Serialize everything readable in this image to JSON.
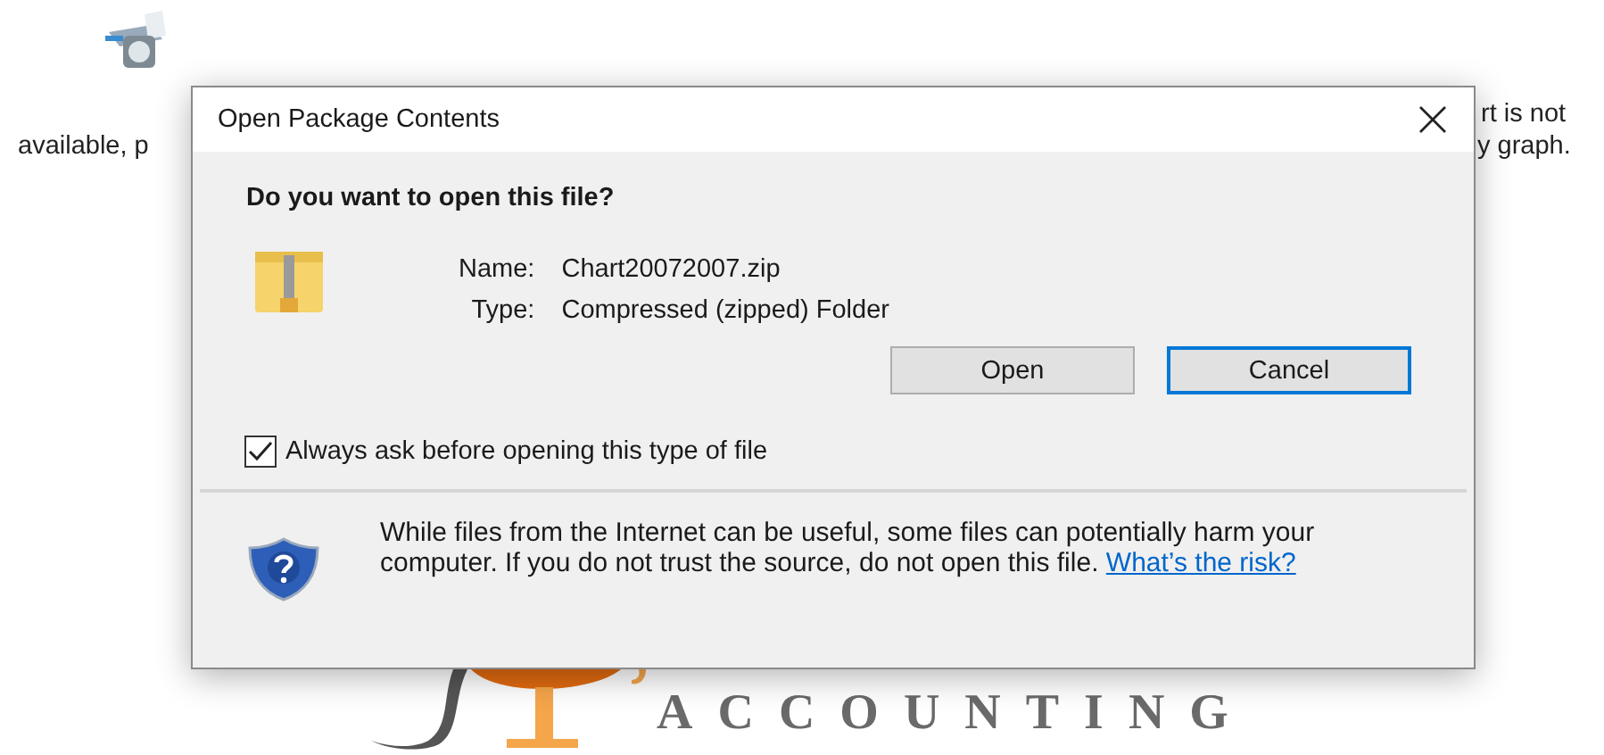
{
  "background": {
    "texts": [
      {
        "kind": "left",
        "text": "available, p"
      },
      {
        "kind": "right-top",
        "text": "rt is not"
      },
      {
        "kind": "right",
        "text": "y graph."
      }
    ],
    "logo": {
      "text": "ACCOUNTING"
    }
  },
  "dialog": {
    "title": "Open Package Contents",
    "heading": "Do you want to open this file?",
    "fields": [
      {
        "label": "Name:",
        "value": "Chart20072007.zip"
      },
      {
        "label": "Type:",
        "value": "Compressed (zipped) Folder"
      }
    ],
    "buttons": [
      {
        "label": "Open",
        "default": false
      },
      {
        "label": "Cancel",
        "default": true
      }
    ],
    "checkbox": {
      "label": "Always ask before opening this type of file",
      "checked": true
    },
    "warning": {
      "text": "While files from the Internet can be useful, some files can potentially harm your computer. If you do not trust the source, do not open this file.",
      "link": "What’s the risk?"
    }
  }
}
